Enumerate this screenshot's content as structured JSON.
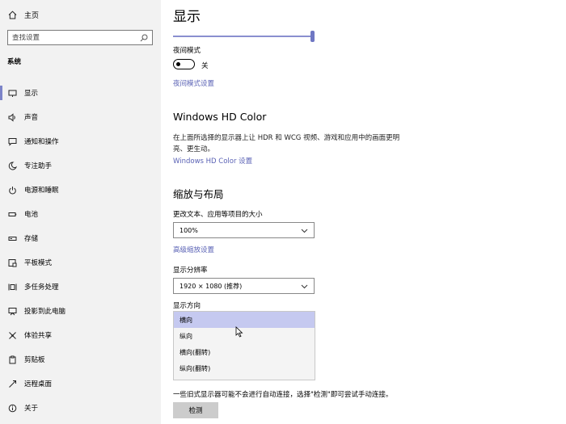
{
  "sidebar": {
    "home_label": "主页",
    "search_placeholder": "查找设置",
    "section_title": "系统",
    "items": [
      {
        "label": "显示",
        "icon": "monitor-icon"
      },
      {
        "label": "声音",
        "icon": "speaker-icon"
      },
      {
        "label": "通知和操作",
        "icon": "message-icon"
      },
      {
        "label": "专注助手",
        "icon": "moon-icon"
      },
      {
        "label": "电源和睡眠",
        "icon": "power-icon"
      },
      {
        "label": "电池",
        "icon": "battery-icon"
      },
      {
        "label": "存储",
        "icon": "storage-icon"
      },
      {
        "label": "平板模式",
        "icon": "tablet-icon"
      },
      {
        "label": "多任务处理",
        "icon": "multitask-icon"
      },
      {
        "label": "投影到此电脑",
        "icon": "project-icon"
      },
      {
        "label": "体验共享",
        "icon": "share-icon"
      },
      {
        "label": "剪贴板",
        "icon": "clipboard-icon"
      },
      {
        "label": "远程桌面",
        "icon": "remote-icon"
      },
      {
        "label": "关于",
        "icon": "info-icon"
      }
    ],
    "active_index": 0
  },
  "main": {
    "title": "显示",
    "brightness_value": 1.0,
    "night_light_label": "夜间模式",
    "night_light_state": "关",
    "night_light_link": "夜间模式设置",
    "hdr_heading": "Windows HD Color",
    "hdr_desc": "在上面所选择的显示器上让 HDR 和 WCG 视频、游戏和应用中的画面更明亮、更生动。",
    "hdr_link": "Windows HD Color 设置",
    "scale_heading": "缩放与布局",
    "scale_label": "更改文本、应用等项目的大小",
    "scale_value": "100%",
    "advanced_scale_link": "高级缩放设置",
    "resolution_label": "显示分辨率",
    "resolution_value": "1920 × 1080 (推荐)",
    "orientation_label": "显示方向",
    "orientation_options": [
      "横向",
      "纵向",
      "横向(翻转)",
      "纵向(翻转)"
    ],
    "orientation_selected": 0,
    "detect_note": "一些旧式显示器可能不会进行自动连接，选择\"检测\"即可尝试手动连接。",
    "detect_button": "检测"
  },
  "colors": {
    "accent": "#7c84c8",
    "link": "#5a62b5",
    "selected_option": "#c5c9f0",
    "sidebar_bg": "#f2f2f2"
  }
}
